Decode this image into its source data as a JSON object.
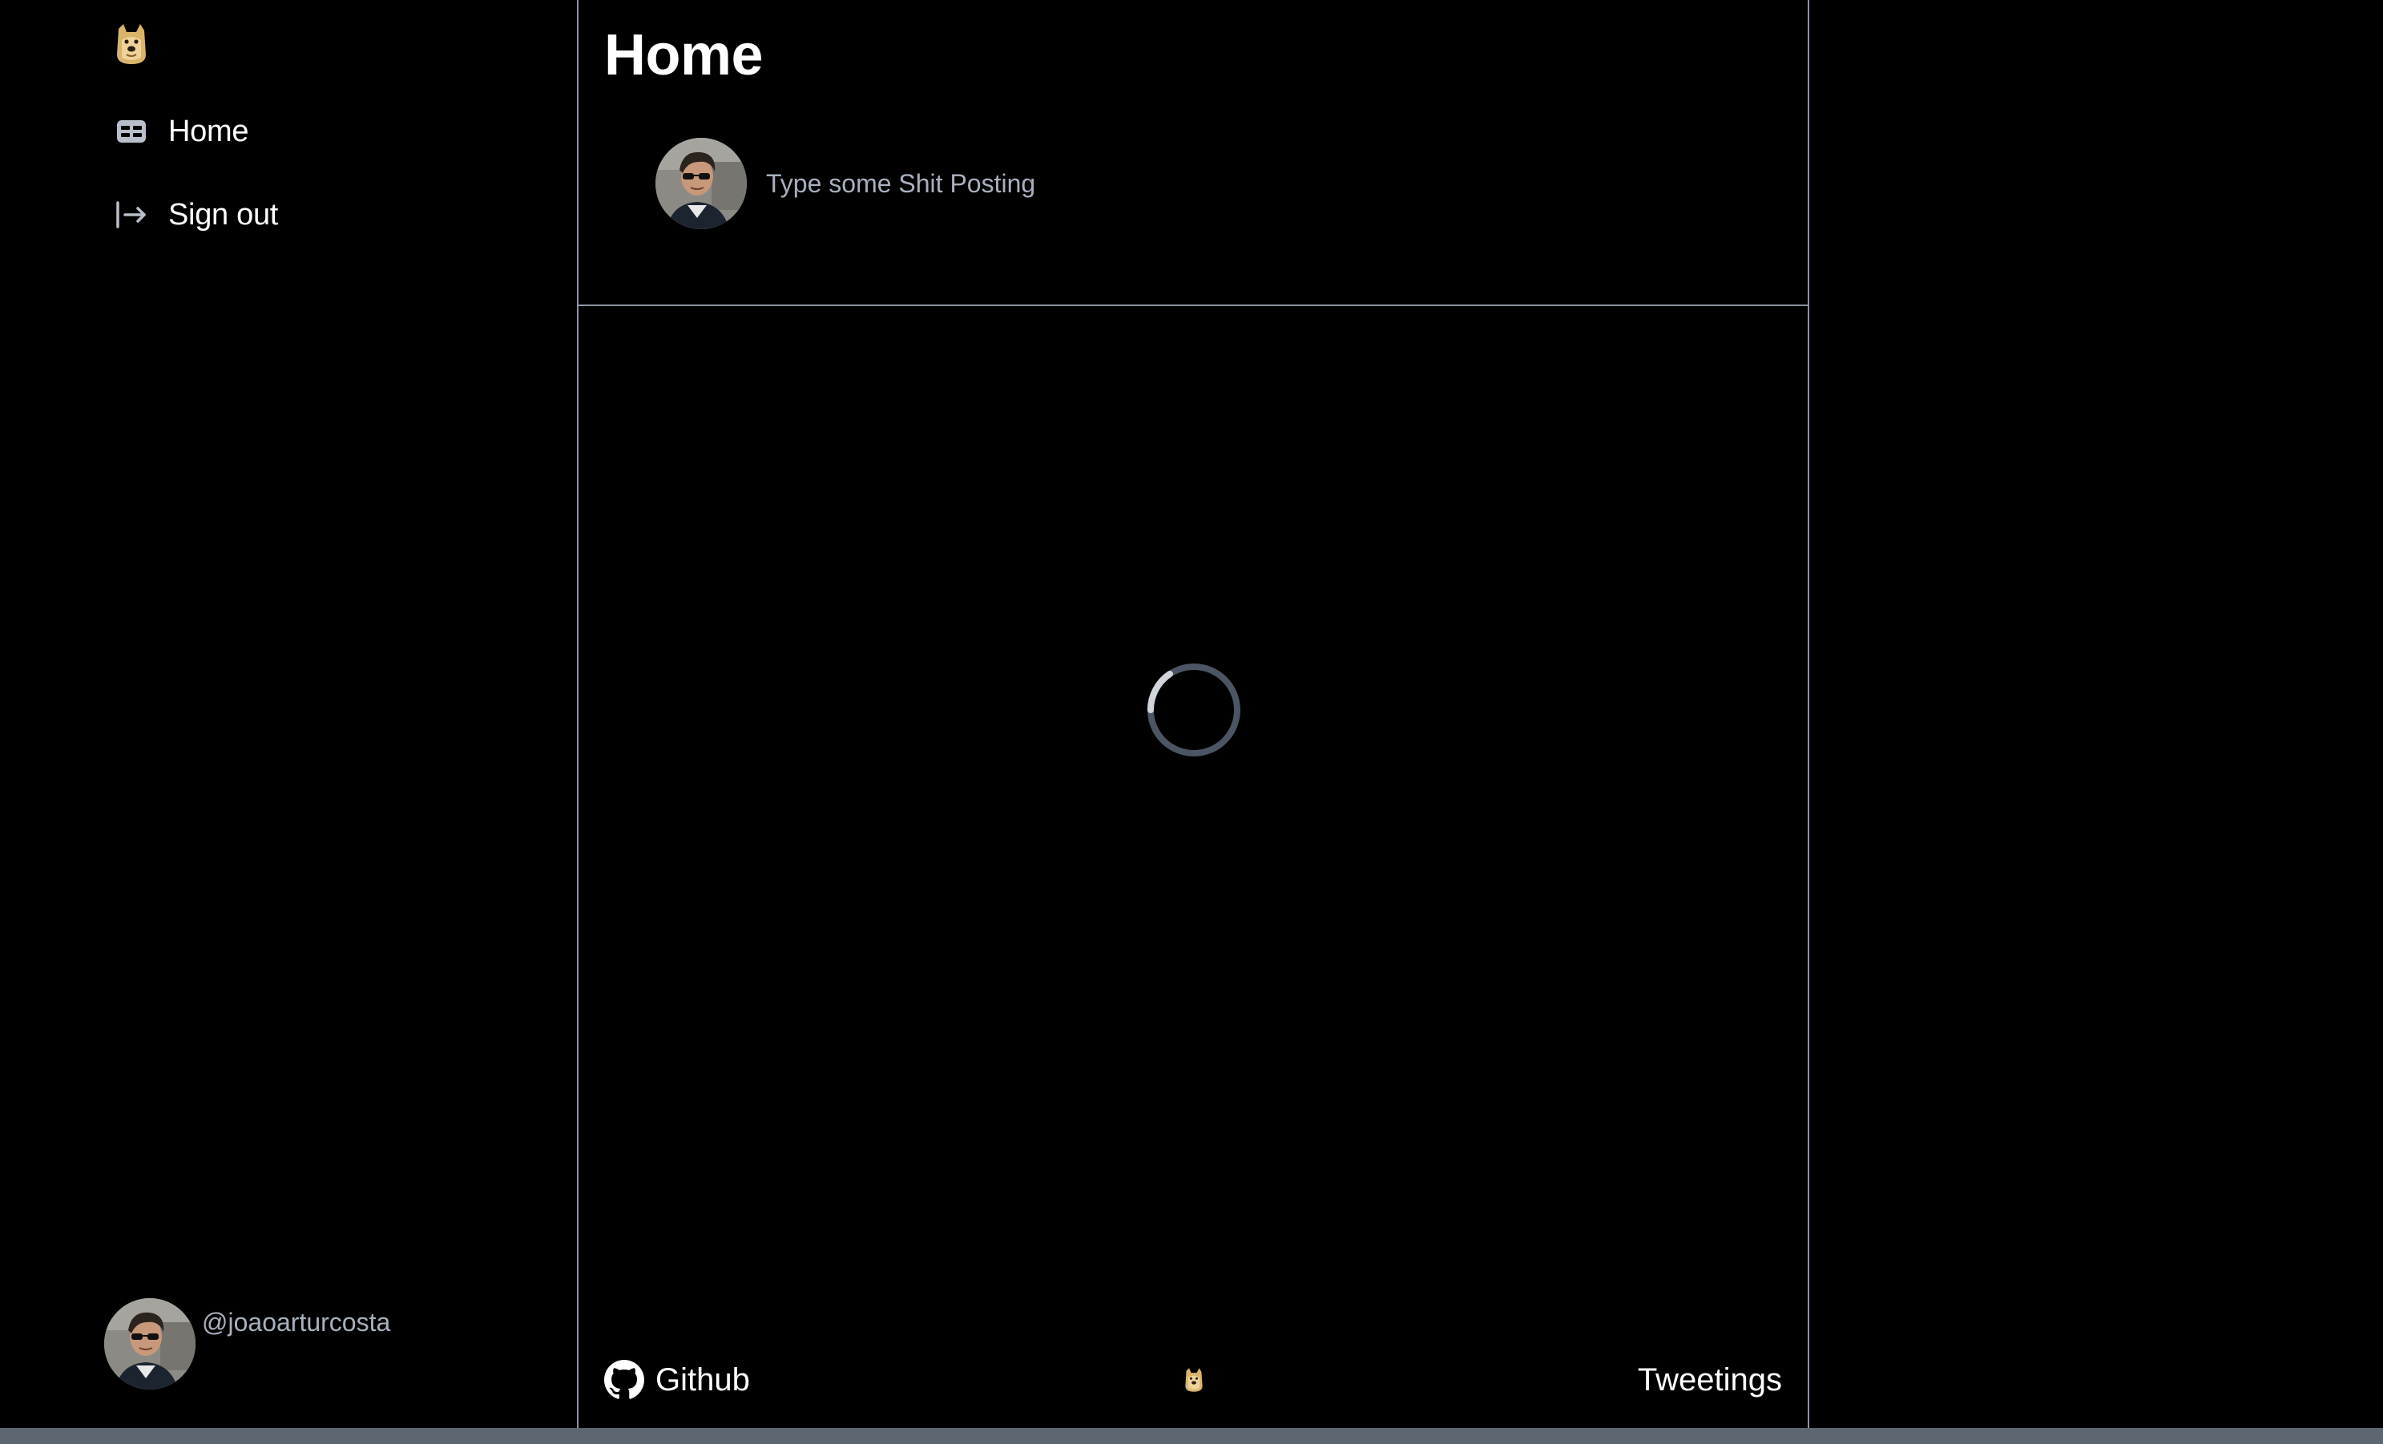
{
  "sidebar": {
    "logo": {
      "icon": "doge-logo-icon"
    },
    "items": [
      {
        "label": "Home",
        "icon": "home-icon"
      },
      {
        "label": "Sign out",
        "icon": "sign-out-icon"
      }
    ],
    "profile": {
      "handle": "@joaoarturcosta",
      "avatar": "user-avatar"
    }
  },
  "main": {
    "title": "Home",
    "composer": {
      "placeholder": "Type some Shit Posting",
      "value": ""
    },
    "feed": {
      "state": "loading"
    },
    "footer": {
      "github_label": "Github",
      "brand_label": "Tweetings",
      "github_icon": "github-icon",
      "center_icon": "doge-logo-icon"
    }
  },
  "colors": {
    "background": "#000000",
    "border": "#8b93a2",
    "muted_text": "#a8b0bd",
    "spinner_track": "#4b5563",
    "spinner_head": "#d1d5db",
    "bottom_bar": "#5b6670"
  }
}
